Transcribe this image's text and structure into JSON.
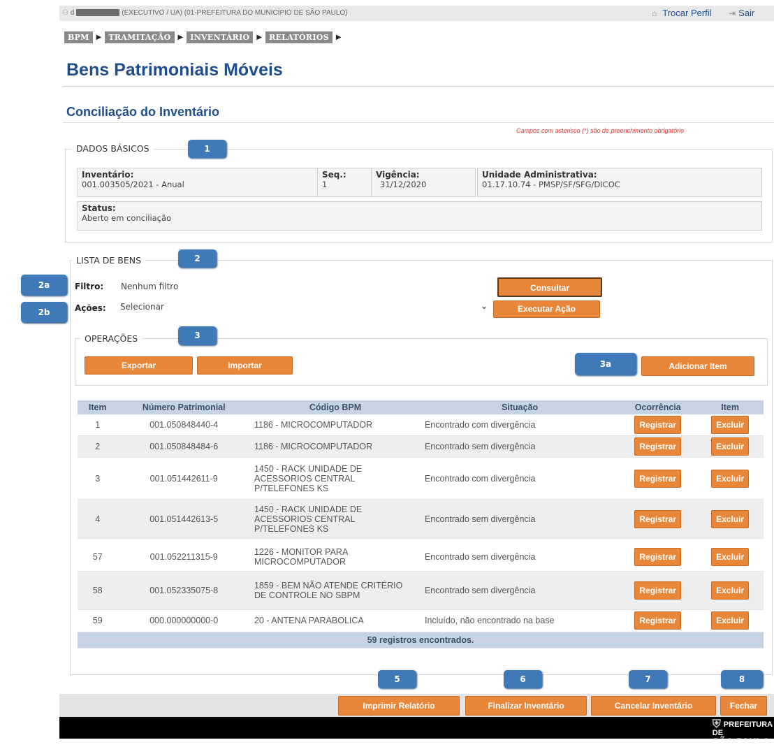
{
  "topbar": {
    "user_prefix": "d",
    "user_context": "(EXECUTIVO / UA) (01-PREFEITURA DO MUNICÍPIO DE SÃO PAULO)",
    "trocar_perfil": "Trocar Perfil",
    "sair": "Sair"
  },
  "menu": [
    "BPM",
    "TRAMITAÇÃO",
    "INVENTÁRIO",
    "RELATÓRIOS"
  ],
  "page_title": "Bens Patrimoniais Móveis",
  "section_title": "Conciliação do Inventário",
  "required_note": "Campos com asterisco (*) são de preenchimento obrigatório",
  "dados_basicos": {
    "legend": "DADOS BÁSICOS",
    "inventario_label": "Inventário:",
    "inventario_value": "001.003505/2021 - Anual",
    "seq_label": "Seq.:",
    "seq_value": "1",
    "vigencia_label": "Vigência:",
    "vigencia_value": "31/12/2020",
    "unidade_label": "Unidade Administrativa:",
    "unidade_value": "01.17.10.74 - PMSP/SF/SFG/DICOC",
    "status_label": "Status:",
    "status_value": "Aberto em conciliação"
  },
  "lista_bens": {
    "legend": "LISTA DE BENS",
    "filtro_label": "Filtro:",
    "filtro_value": "Nenhum filtro",
    "consultar": "Consultar",
    "acoes_label": "Ações:",
    "acoes_selected": "Selecionar",
    "executar": "Executar Ação"
  },
  "operacoes": {
    "legend": "OPERAÇÕES",
    "exportar": "Exportar",
    "importar": "Importar",
    "adicionar": "Adicionar Item"
  },
  "badges": {
    "b1": "1",
    "b2": "2",
    "b2a": "2a",
    "b2b": "2b",
    "b3": "3",
    "b3a": "3a",
    "b5": "5",
    "b6": "6",
    "b7": "7",
    "b8": "8"
  },
  "table": {
    "headers": [
      "Item",
      "Número Patrimonial",
      "Código BPM",
      "Situação",
      "Ocorrência",
      "Item"
    ],
    "registrar": "Registrar",
    "excluir": "Excluir",
    "rows": [
      {
        "item": "1",
        "numero": "001.050848440-4",
        "codigo": "1186 - MICROCOMPUTADOR",
        "situacao": "Encontrado com divergência"
      },
      {
        "item": "2",
        "numero": "001.050848484-6",
        "codigo": "1186 - MICROCOMPUTADOR",
        "situacao": "Encontrado sem divergência"
      },
      {
        "item": "3",
        "numero": "001.051442611-9",
        "codigo": "1450 - RACK UNIDADE DE ACESSORIOS CENTRAL P/TELEFONES KS",
        "situacao": "Encontrado com divergência"
      },
      {
        "item": "4",
        "numero": "001.051442613-5",
        "codigo": "1450 - RACK UNIDADE DE ACESSORIOS CENTRAL P/TELEFONES KS",
        "situacao": "Encontrado sem divergência"
      },
      {
        "item": "57",
        "numero": "001.052211315-9",
        "codigo": "1226 - MONITOR PARA MICROCOMPUTADOR",
        "situacao": "Encontrado sem divergência"
      },
      {
        "item": "58",
        "numero": "001.052335075-8",
        "codigo": "1859 - BEM NÃO ATENDE CRITÉRIO DE CONTROLE NO SBPM",
        "situacao": "Encontrado sem divergência"
      },
      {
        "item": "59",
        "numero": "000.000000000-0",
        "codigo": "20 - ANTENA PARABOLICA",
        "situacao": "Incluído, não encontrado na base"
      }
    ],
    "footer": "59 registros encontrados."
  },
  "bottom_buttons": {
    "imprimir": "Imprimir Relatório",
    "finalizar": "Finalizar Inventário",
    "cancelar": "Cancelar Inventário",
    "fechar": "Fechar"
  },
  "logo": {
    "line1": "PREFEITURA DE",
    "line2": "SÃO PAULO"
  },
  "colors": {
    "accent_blue": "#1f4e8c",
    "button_orange": "#e8873a",
    "badge_blue": "#3f79b8",
    "table_header": "#c6d3e3"
  }
}
